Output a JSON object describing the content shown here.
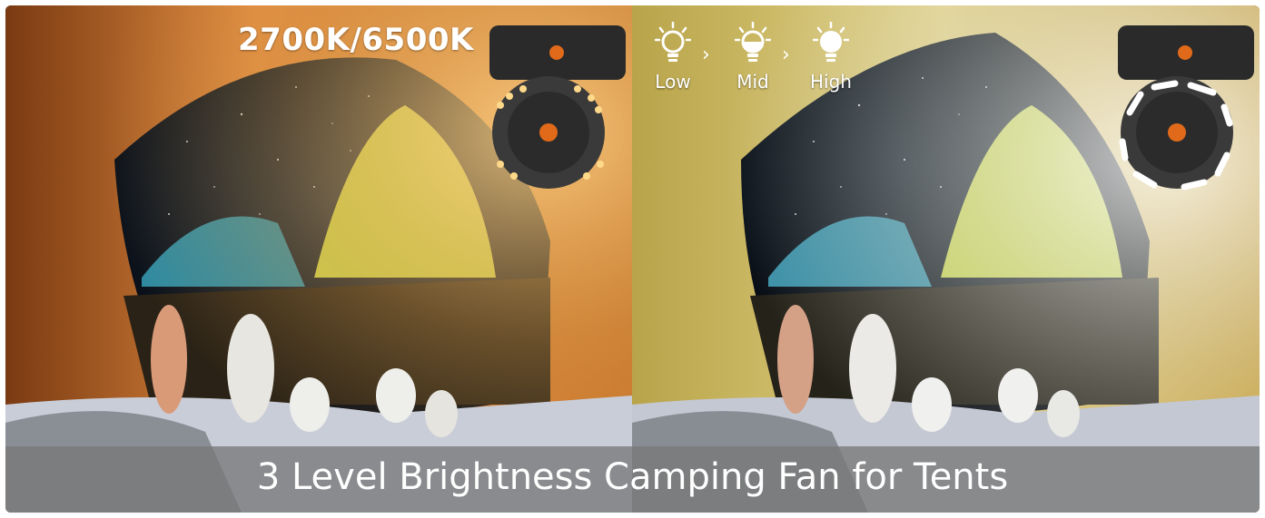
{
  "left_panel": {
    "heading": "2700K/6500K",
    "light_color": "#f5c25a"
  },
  "right_panel": {
    "brightness_levels": [
      {
        "label": "Low",
        "icon": "bulb-low-icon"
      },
      {
        "label": "Mid",
        "icon": "bulb-mid-icon"
      },
      {
        "label": "High",
        "icon": "bulb-high-icon"
      }
    ],
    "separator": "›",
    "light_color": "#ffffff"
  },
  "banner": {
    "text": "3 Level Brightness Camping Fan for Tents"
  }
}
